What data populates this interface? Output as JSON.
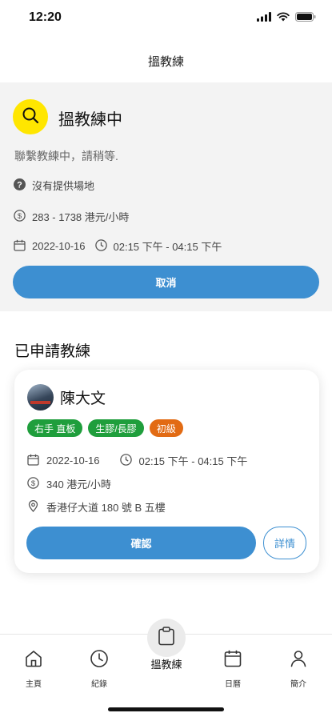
{
  "status_bar": {
    "time": "12:20"
  },
  "nav": {
    "title": "搵教練"
  },
  "search": {
    "title": "搵教練中",
    "subtitle": "聯繫教練中，請稍等.",
    "venue": "沒有提供場地",
    "price_range": "283 - 1738 港元/小時",
    "date": "2022-10-16",
    "time_range": "02:15 下午 - 04:15 下午",
    "cancel_label": "取消"
  },
  "applied": {
    "section_title": "已申請教練",
    "coach": {
      "name": "陳大文",
      "tags": [
        {
          "label": "右手 直板",
          "color": "#1f9e3c"
        },
        {
          "label": "生膠/長膠",
          "color": "#1f9e3c"
        },
        {
          "label": "初級",
          "color": "#e26b14"
        }
      ],
      "date": "2022-10-16",
      "time_range": "02:15 下午 - 04:15 下午",
      "price": "340 港元/小時",
      "address": "香港仔大道 180 號 B 五樓",
      "confirm_label": "確認",
      "detail_label": "詳情"
    }
  },
  "tab_bar": {
    "items": [
      {
        "label": "主頁",
        "icon": "home-icon"
      },
      {
        "label": "紀錄",
        "icon": "clock-icon"
      },
      {
        "label": "搵教練",
        "icon": "clipboard-icon"
      },
      {
        "label": "日曆",
        "icon": "calendar-icon"
      },
      {
        "label": "簡介",
        "icon": "person-icon"
      }
    ]
  },
  "colors": {
    "accent": "#3d8fd1",
    "highlight": "#ffe600",
    "panel_bg": "#f3f3f3"
  }
}
